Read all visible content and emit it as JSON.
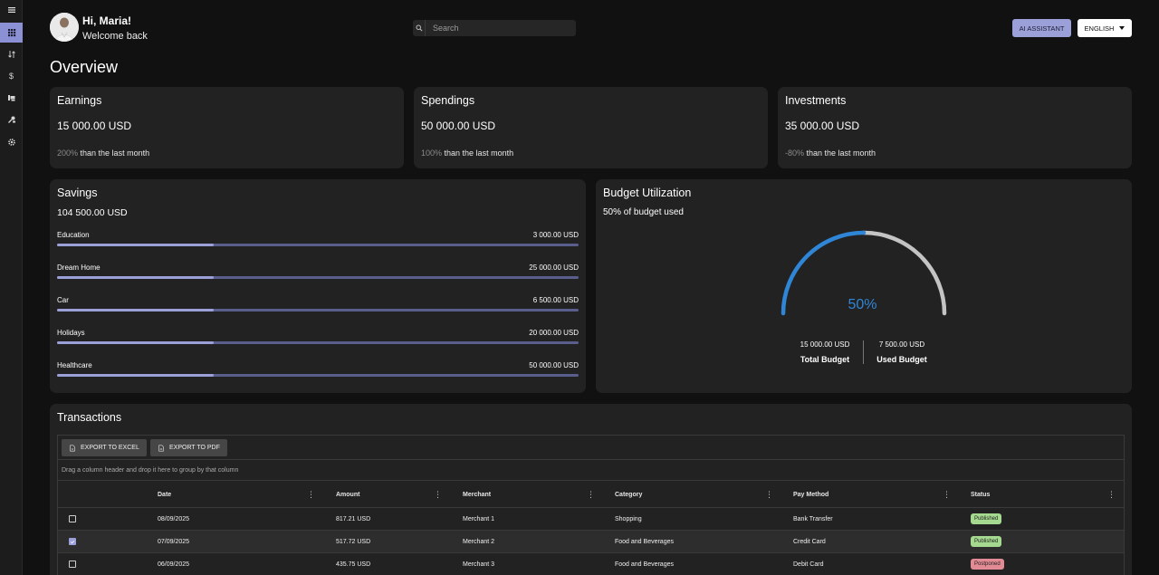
{
  "header": {
    "greeting": "Hi, Maria!",
    "welcome": "Welcome back",
    "search_placeholder": "Search",
    "ai_button": "AI ASSISTANT",
    "language": "ENGLISH"
  },
  "sidebar": {
    "items": [
      {
        "name": "menu-icon"
      },
      {
        "name": "dashboard-icon",
        "active": true
      },
      {
        "name": "transfer-icon"
      },
      {
        "name": "dollar-icon"
      },
      {
        "name": "reports-icon"
      },
      {
        "name": "tools-icon"
      },
      {
        "name": "gear-icon"
      }
    ]
  },
  "page": {
    "title": "Overview"
  },
  "earnings": {
    "title": "Earnings",
    "value": "15 000.00 USD",
    "pct": "200%",
    "suffix": " than the last month"
  },
  "spendings": {
    "title": "Spendings",
    "value": "50 000.00 USD",
    "pct": "100%",
    "suffix": " than the last month"
  },
  "investments": {
    "title": "Investments",
    "value": "35 000.00 USD",
    "pct": "-80%",
    "suffix": " than the last month"
  },
  "savings": {
    "title": "Savings",
    "total": "104 500.00 USD",
    "items": [
      {
        "label": "Education",
        "amount": "3 000.00 USD",
        "progress": 0.3
      },
      {
        "label": "Dream Home",
        "amount": "25 000.00 USD",
        "progress": 0.3
      },
      {
        "label": "Car",
        "amount": "6 500.00 USD",
        "progress": 0.3
      },
      {
        "label": "Holidays",
        "amount": "20 000.00 USD",
        "progress": 0.3
      },
      {
        "label": "Healthcare",
        "amount": "50 000.00 USD",
        "progress": 0.3
      }
    ]
  },
  "budget": {
    "title": "Budget Utilization",
    "subtitle": "50% of budget used",
    "percent_label": "50%",
    "fraction": 0.5,
    "total_amount": "15 000.00 USD",
    "total_label": "Total Budget",
    "used_amount": "7 500.00 USD",
    "used_label": "Used Budget",
    "used_color": "#2f86d6",
    "rest_color": "#c4c4c4"
  },
  "transactions": {
    "title": "Transactions",
    "export_excel": "EXPORT TO EXCEL",
    "export_pdf": "EXPORT TO PDF",
    "group_hint": "Drag a column header and drop it here to group by that column",
    "columns": [
      "Date",
      "Amount",
      "Merchant",
      "Category",
      "Pay Method",
      "Status"
    ],
    "rows": [
      {
        "date": "08/09/2025",
        "amount": "817.21 USD",
        "merchant": "Merchant 1",
        "category": "Shopping",
        "pay": "Bank Transfer",
        "status": "Published",
        "checked": false
      },
      {
        "date": "07/09/2025",
        "amount": "517.72 USD",
        "merchant": "Merchant 2",
        "category": "Food and Beverages",
        "pay": "Credit Card",
        "status": "Published",
        "checked": true
      },
      {
        "date": "06/09/2025",
        "amount": "435.75 USD",
        "merchant": "Merchant 3",
        "category": "Food and Beverages",
        "pay": "Debit Card",
        "status": "Postponed",
        "checked": false
      }
    ]
  }
}
